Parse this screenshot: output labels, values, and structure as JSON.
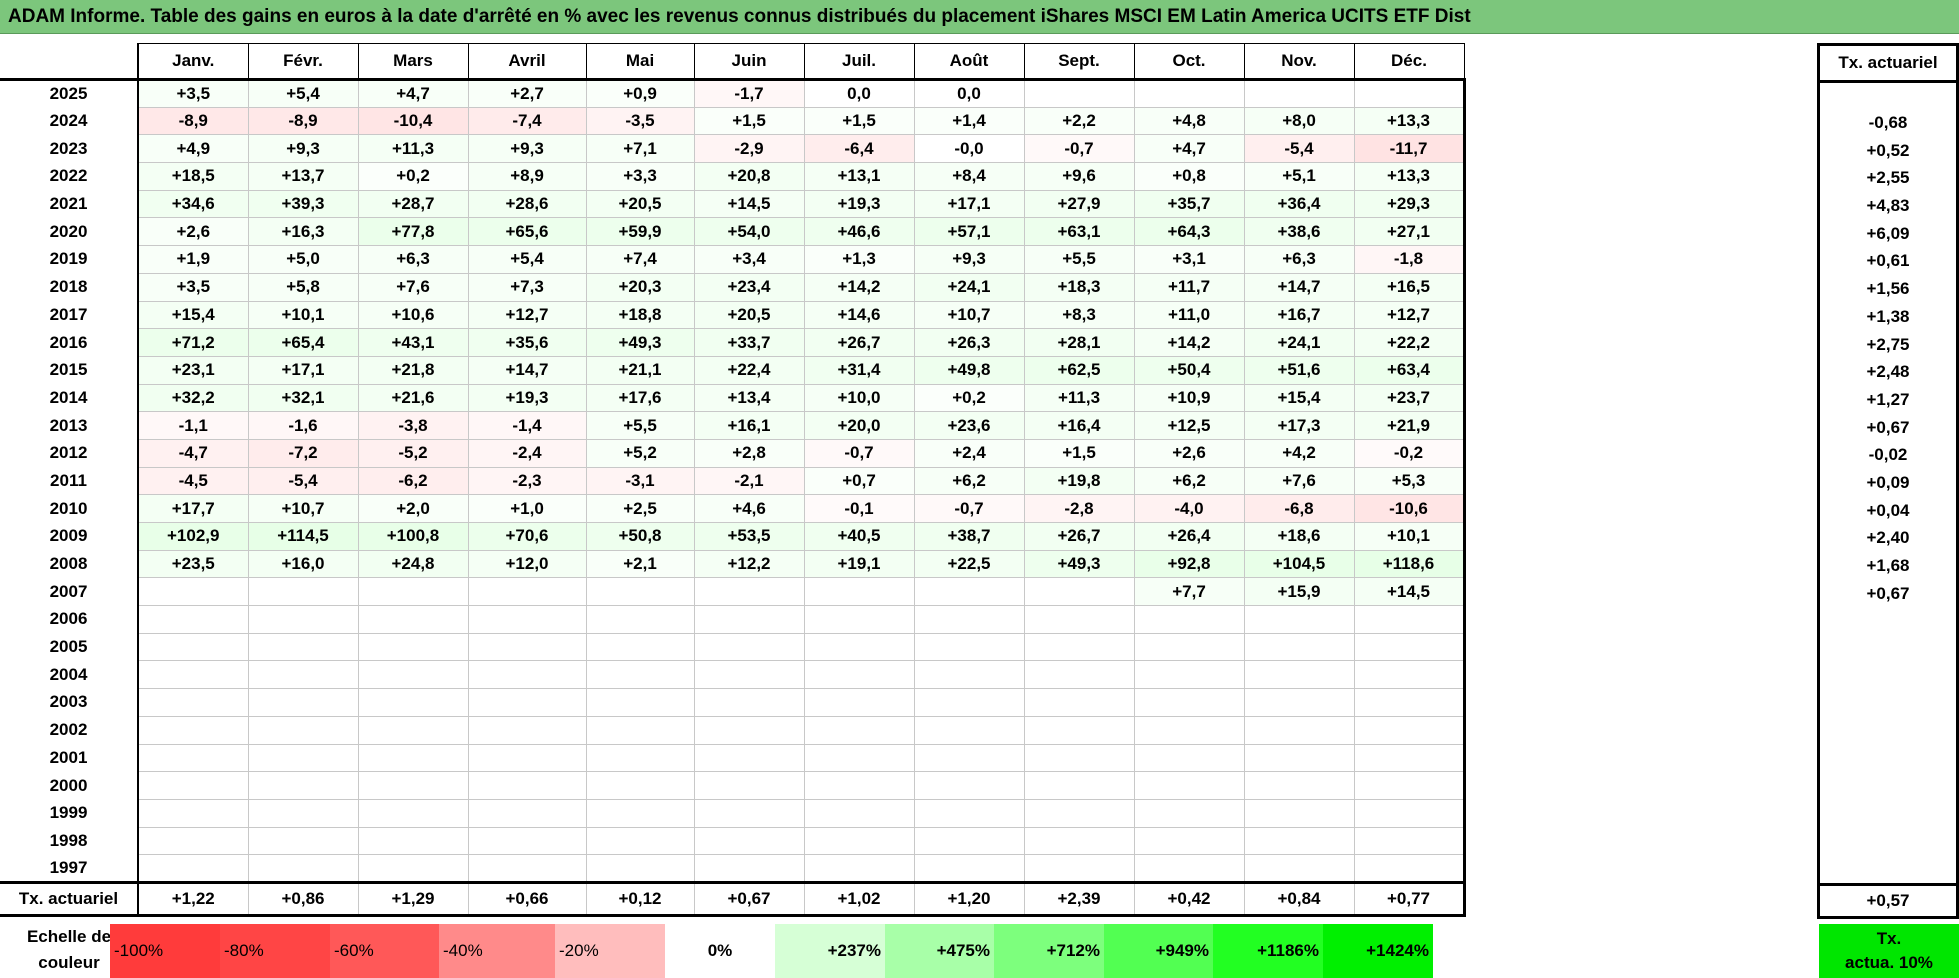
{
  "title": "ADAM Informe. Table des gains en euros à la date d'arrêté en % avec les revenus connus distribués du placement iShares MSCI EM Latin America UCITS ETF Dist",
  "months": [
    "Janv.",
    "Févr.",
    "Mars",
    "Avril",
    "Mai",
    "Juin",
    "Juil.",
    "Août",
    "Sept.",
    "Oct.",
    "Nov.",
    "Déc."
  ],
  "side_header": "Tx. actuariel",
  "rows": [
    {
      "year": "2025",
      "values": [
        "+3,5",
        "+5,4",
        "+4,7",
        "+2,7",
        "+0,9",
        "-1,7",
        "0,0",
        "0,0",
        "",
        "",
        "",
        ""
      ],
      "rate": ""
    },
    {
      "year": "2024",
      "values": [
        "-8,9",
        "-8,9",
        "-10,4",
        "-7,4",
        "-3,5",
        "+1,5",
        "+1,5",
        "+1,4",
        "+2,2",
        "+4,8",
        "+8,0",
        "+13,3"
      ],
      "rate": "-0,68"
    },
    {
      "year": "2023",
      "values": [
        "+4,9",
        "+9,3",
        "+11,3",
        "+9,3",
        "+7,1",
        "-2,9",
        "-6,4",
        "-0,0",
        "-0,7",
        "+4,7",
        "-5,4",
        "-11,7"
      ],
      "rate": "+0,52"
    },
    {
      "year": "2022",
      "values": [
        "+18,5",
        "+13,7",
        "+0,2",
        "+8,9",
        "+3,3",
        "+20,8",
        "+13,1",
        "+8,4",
        "+9,6",
        "+0,8",
        "+5,1",
        "+13,3"
      ],
      "rate": "+2,55"
    },
    {
      "year": "2021",
      "values": [
        "+34,6",
        "+39,3",
        "+28,7",
        "+28,6",
        "+20,5",
        "+14,5",
        "+19,3",
        "+17,1",
        "+27,9",
        "+35,7",
        "+36,4",
        "+29,3"
      ],
      "rate": "+4,83"
    },
    {
      "year": "2020",
      "values": [
        "+2,6",
        "+16,3",
        "+77,8",
        "+65,6",
        "+59,9",
        "+54,0",
        "+46,6",
        "+57,1",
        "+63,1",
        "+64,3",
        "+38,6",
        "+27,1"
      ],
      "rate": "+6,09"
    },
    {
      "year": "2019",
      "values": [
        "+1,9",
        "+5,0",
        "+6,3",
        "+5,4",
        "+7,4",
        "+3,4",
        "+1,3",
        "+9,3",
        "+5,5",
        "+3,1",
        "+6,3",
        "-1,8"
      ],
      "rate": "+0,61"
    },
    {
      "year": "2018",
      "values": [
        "+3,5",
        "+5,8",
        "+7,6",
        "+7,3",
        "+20,3",
        "+23,4",
        "+14,2",
        "+24,1",
        "+18,3",
        "+11,7",
        "+14,7",
        "+16,5"
      ],
      "rate": "+1,56"
    },
    {
      "year": "2017",
      "values": [
        "+15,4",
        "+10,1",
        "+10,6",
        "+12,7",
        "+18,8",
        "+20,5",
        "+14,6",
        "+10,7",
        "+8,3",
        "+11,0",
        "+16,7",
        "+12,7"
      ],
      "rate": "+1,38"
    },
    {
      "year": "2016",
      "values": [
        "+71,2",
        "+65,4",
        "+43,1",
        "+35,6",
        "+49,3",
        "+33,7",
        "+26,7",
        "+26,3",
        "+28,1",
        "+14,2",
        "+24,1",
        "+22,2"
      ],
      "rate": "+2,75"
    },
    {
      "year": "2015",
      "values": [
        "+23,1",
        "+17,1",
        "+21,8",
        "+14,7",
        "+21,1",
        "+22,4",
        "+31,4",
        "+49,8",
        "+62,5",
        "+50,4",
        "+51,6",
        "+63,4"
      ],
      "rate": "+2,48"
    },
    {
      "year": "2014",
      "values": [
        "+32,2",
        "+32,1",
        "+21,6",
        "+19,3",
        "+17,6",
        "+13,4",
        "+10,0",
        "+0,2",
        "+11,3",
        "+10,9",
        "+15,4",
        "+23,7"
      ],
      "rate": "+1,27"
    },
    {
      "year": "2013",
      "values": [
        "-1,1",
        "-1,6",
        "-3,8",
        "-1,4",
        "+5,5",
        "+16,1",
        "+20,0",
        "+23,6",
        "+16,4",
        "+12,5",
        "+17,3",
        "+21,9"
      ],
      "rate": "+0,67"
    },
    {
      "year": "2012",
      "values": [
        "-4,7",
        "-7,2",
        "-5,2",
        "-2,4",
        "+5,2",
        "+2,8",
        "-0,7",
        "+2,4",
        "+1,5",
        "+2,6",
        "+4,2",
        "-0,2"
      ],
      "rate": "-0,02"
    },
    {
      "year": "2011",
      "values": [
        "-4,5",
        "-5,4",
        "-6,2",
        "-2,3",
        "-3,1",
        "-2,1",
        "+0,7",
        "+6,2",
        "+19,8",
        "+6,2",
        "+7,6",
        "+5,3"
      ],
      "rate": "+0,09"
    },
    {
      "year": "2010",
      "values": [
        "+17,7",
        "+10,7",
        "+2,0",
        "+1,0",
        "+2,5",
        "+4,6",
        "-0,1",
        "-0,7",
        "-2,8",
        "-4,0",
        "-6,8",
        "-10,6"
      ],
      "rate": "+0,04"
    },
    {
      "year": "2009",
      "values": [
        "+102,9",
        "+114,5",
        "+100,8",
        "+70,6",
        "+50,8",
        "+53,5",
        "+40,5",
        "+38,7",
        "+26,7",
        "+26,4",
        "+18,6",
        "+10,1"
      ],
      "rate": "+2,40"
    },
    {
      "year": "2008",
      "values": [
        "+23,5",
        "+16,0",
        "+24,8",
        "+12,0",
        "+2,1",
        "+12,2",
        "+19,1",
        "+22,5",
        "+49,3",
        "+92,8",
        "+104,5",
        "+118,6"
      ],
      "rate": "+1,68"
    },
    {
      "year": "2007",
      "values": [
        "",
        "",
        "",
        "",
        "",
        "",
        "",
        "",
        "",
        "+7,7",
        "+15,9",
        "+14,5"
      ],
      "rate": "+0,67"
    },
    {
      "year": "2006",
      "values": [
        "",
        "",
        "",
        "",
        "",
        "",
        "",
        "",
        "",
        "",
        "",
        ""
      ],
      "rate": ""
    },
    {
      "year": "2005",
      "values": [
        "",
        "",
        "",
        "",
        "",
        "",
        "",
        "",
        "",
        "",
        "",
        ""
      ],
      "rate": ""
    },
    {
      "year": "2004",
      "values": [
        "",
        "",
        "",
        "",
        "",
        "",
        "",
        "",
        "",
        "",
        "",
        ""
      ],
      "rate": ""
    },
    {
      "year": "2003",
      "values": [
        "",
        "",
        "",
        "",
        "",
        "",
        "",
        "",
        "",
        "",
        "",
        ""
      ],
      "rate": ""
    },
    {
      "year": "2002",
      "values": [
        "",
        "",
        "",
        "",
        "",
        "",
        "",
        "",
        "",
        "",
        "",
        ""
      ],
      "rate": ""
    },
    {
      "year": "2001",
      "values": [
        "",
        "",
        "",
        "",
        "",
        "",
        "",
        "",
        "",
        "",
        "",
        ""
      ],
      "rate": ""
    },
    {
      "year": "2000",
      "values": [
        "",
        "",
        "",
        "",
        "",
        "",
        "",
        "",
        "",
        "",
        "",
        ""
      ],
      "rate": ""
    },
    {
      "year": "1999",
      "values": [
        "",
        "",
        "",
        "",
        "",
        "",
        "",
        "",
        "",
        "",
        "",
        ""
      ],
      "rate": ""
    },
    {
      "year": "1998",
      "values": [
        "",
        "",
        "",
        "",
        "",
        "",
        "",
        "",
        "",
        "",
        "",
        ""
      ],
      "rate": ""
    },
    {
      "year": "1997",
      "values": [
        "",
        "",
        "",
        "",
        "",
        "",
        "",
        "",
        "",
        "",
        "",
        ""
      ],
      "rate": ""
    }
  ],
  "footer": {
    "label": "Tx. actuariel",
    "values": [
      "+1,22",
      "+0,86",
      "+1,29",
      "+0,66",
      "+0,12",
      "+0,67",
      "+1,02",
      "+1,20",
      "+2,39",
      "+0,42",
      "+0,84",
      "+0,77"
    ],
    "rate": "+0,57"
  },
  "scale": {
    "label_line1": "Echelle de",
    "label_line2": "couleur",
    "items": [
      {
        "label": "-100%",
        "color": "#ff3b3b",
        "kind": "neg"
      },
      {
        "label": "-80%",
        "color": "#ff4545",
        "kind": "neg"
      },
      {
        "label": "-60%",
        "color": "#ff5858",
        "kind": "neg"
      },
      {
        "label": "-40%",
        "color": "#ff8a8a",
        "kind": "neg"
      },
      {
        "label": "-20%",
        "color": "#ffbdbd",
        "kind": "neg"
      },
      {
        "label": "0%",
        "color": "#ffffff",
        "kind": "zero"
      },
      {
        "label": "+237%",
        "color": "#d6ffd6",
        "kind": "pos"
      },
      {
        "label": "+475%",
        "color": "#a8ffa8",
        "kind": "pos"
      },
      {
        "label": "+712%",
        "color": "#7dff7d",
        "kind": "pos"
      },
      {
        "label": "+949%",
        "color": "#52ff52",
        "kind": "pos"
      },
      {
        "label": "+1186%",
        "color": "#22ff22",
        "kind": "pos"
      },
      {
        "label": "+1424%",
        "color": "#00f000",
        "kind": "pos"
      }
    ],
    "target_line1": "Tx.",
    "target_line2": "actua. 10%",
    "target_color": "#00e600"
  }
}
